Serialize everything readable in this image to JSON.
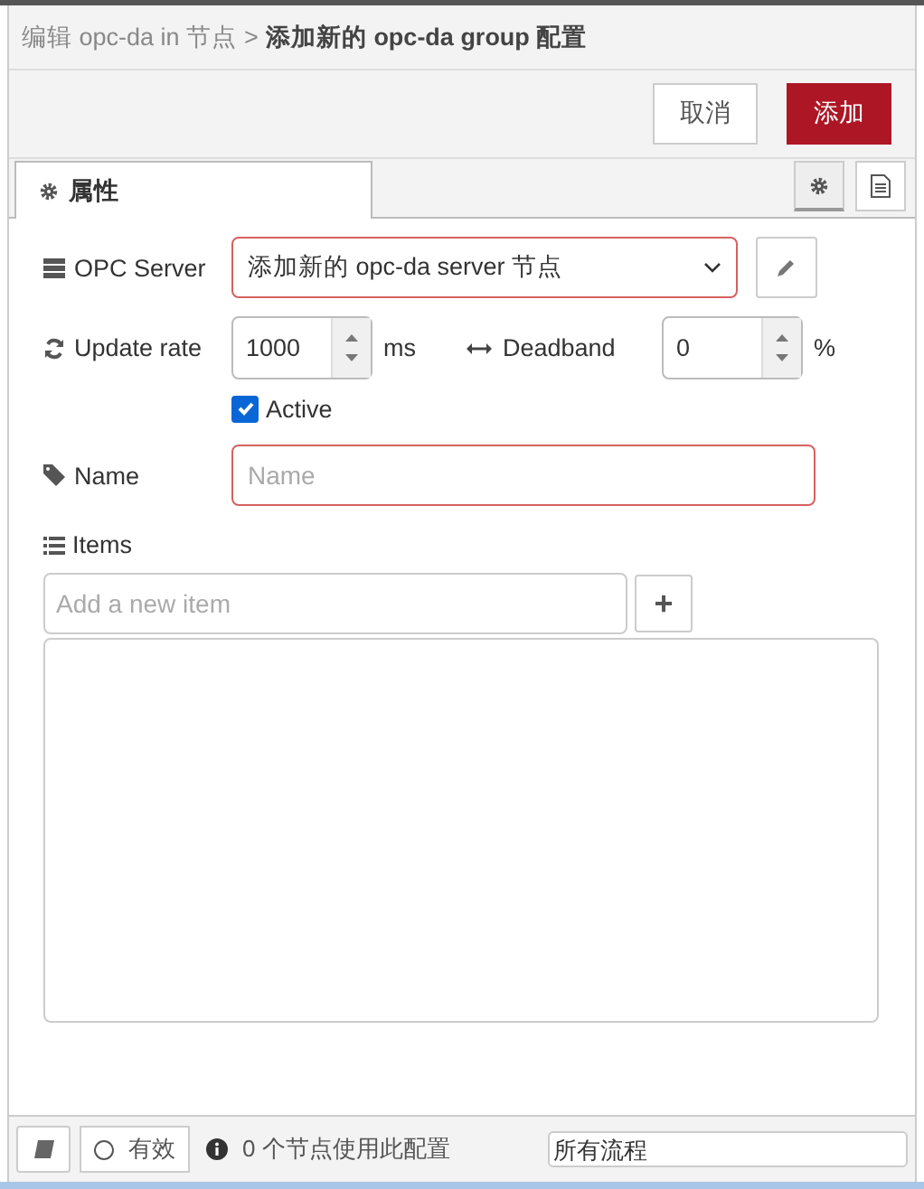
{
  "breadcrumb": {
    "parent": "编辑 opc-da in 节点",
    "separator": ">",
    "current": "添加新的 opc-da group 配置"
  },
  "buttons": [
    {
      "label": "取消",
      "kind": "secondary"
    },
    {
      "label": "添加",
      "kind": "primary"
    }
  ],
  "tabs": [
    {
      "label": "属性",
      "selected": true
    }
  ],
  "form": {
    "server": {
      "label": "OPC Server",
      "value": "添加新的 opc-da server 节点",
      "invalid": true
    },
    "update_rate": {
      "label": "Update rate",
      "value": "1000",
      "unit": "ms"
    },
    "deadband": {
      "label": "Deadband",
      "value": "0",
      "unit": "%"
    },
    "active": {
      "label": "Active",
      "checked": true
    },
    "name": {
      "label": "Name",
      "placeholder": "Name",
      "invalid": true
    },
    "items": {
      "label": "Items",
      "placeholder": "Add a new item",
      "add": "+"
    }
  },
  "footer": {
    "enabled": {
      "label": "有效",
      "on": false
    },
    "usage": "0 个节点使用此配置",
    "scope": "所有流程"
  }
}
